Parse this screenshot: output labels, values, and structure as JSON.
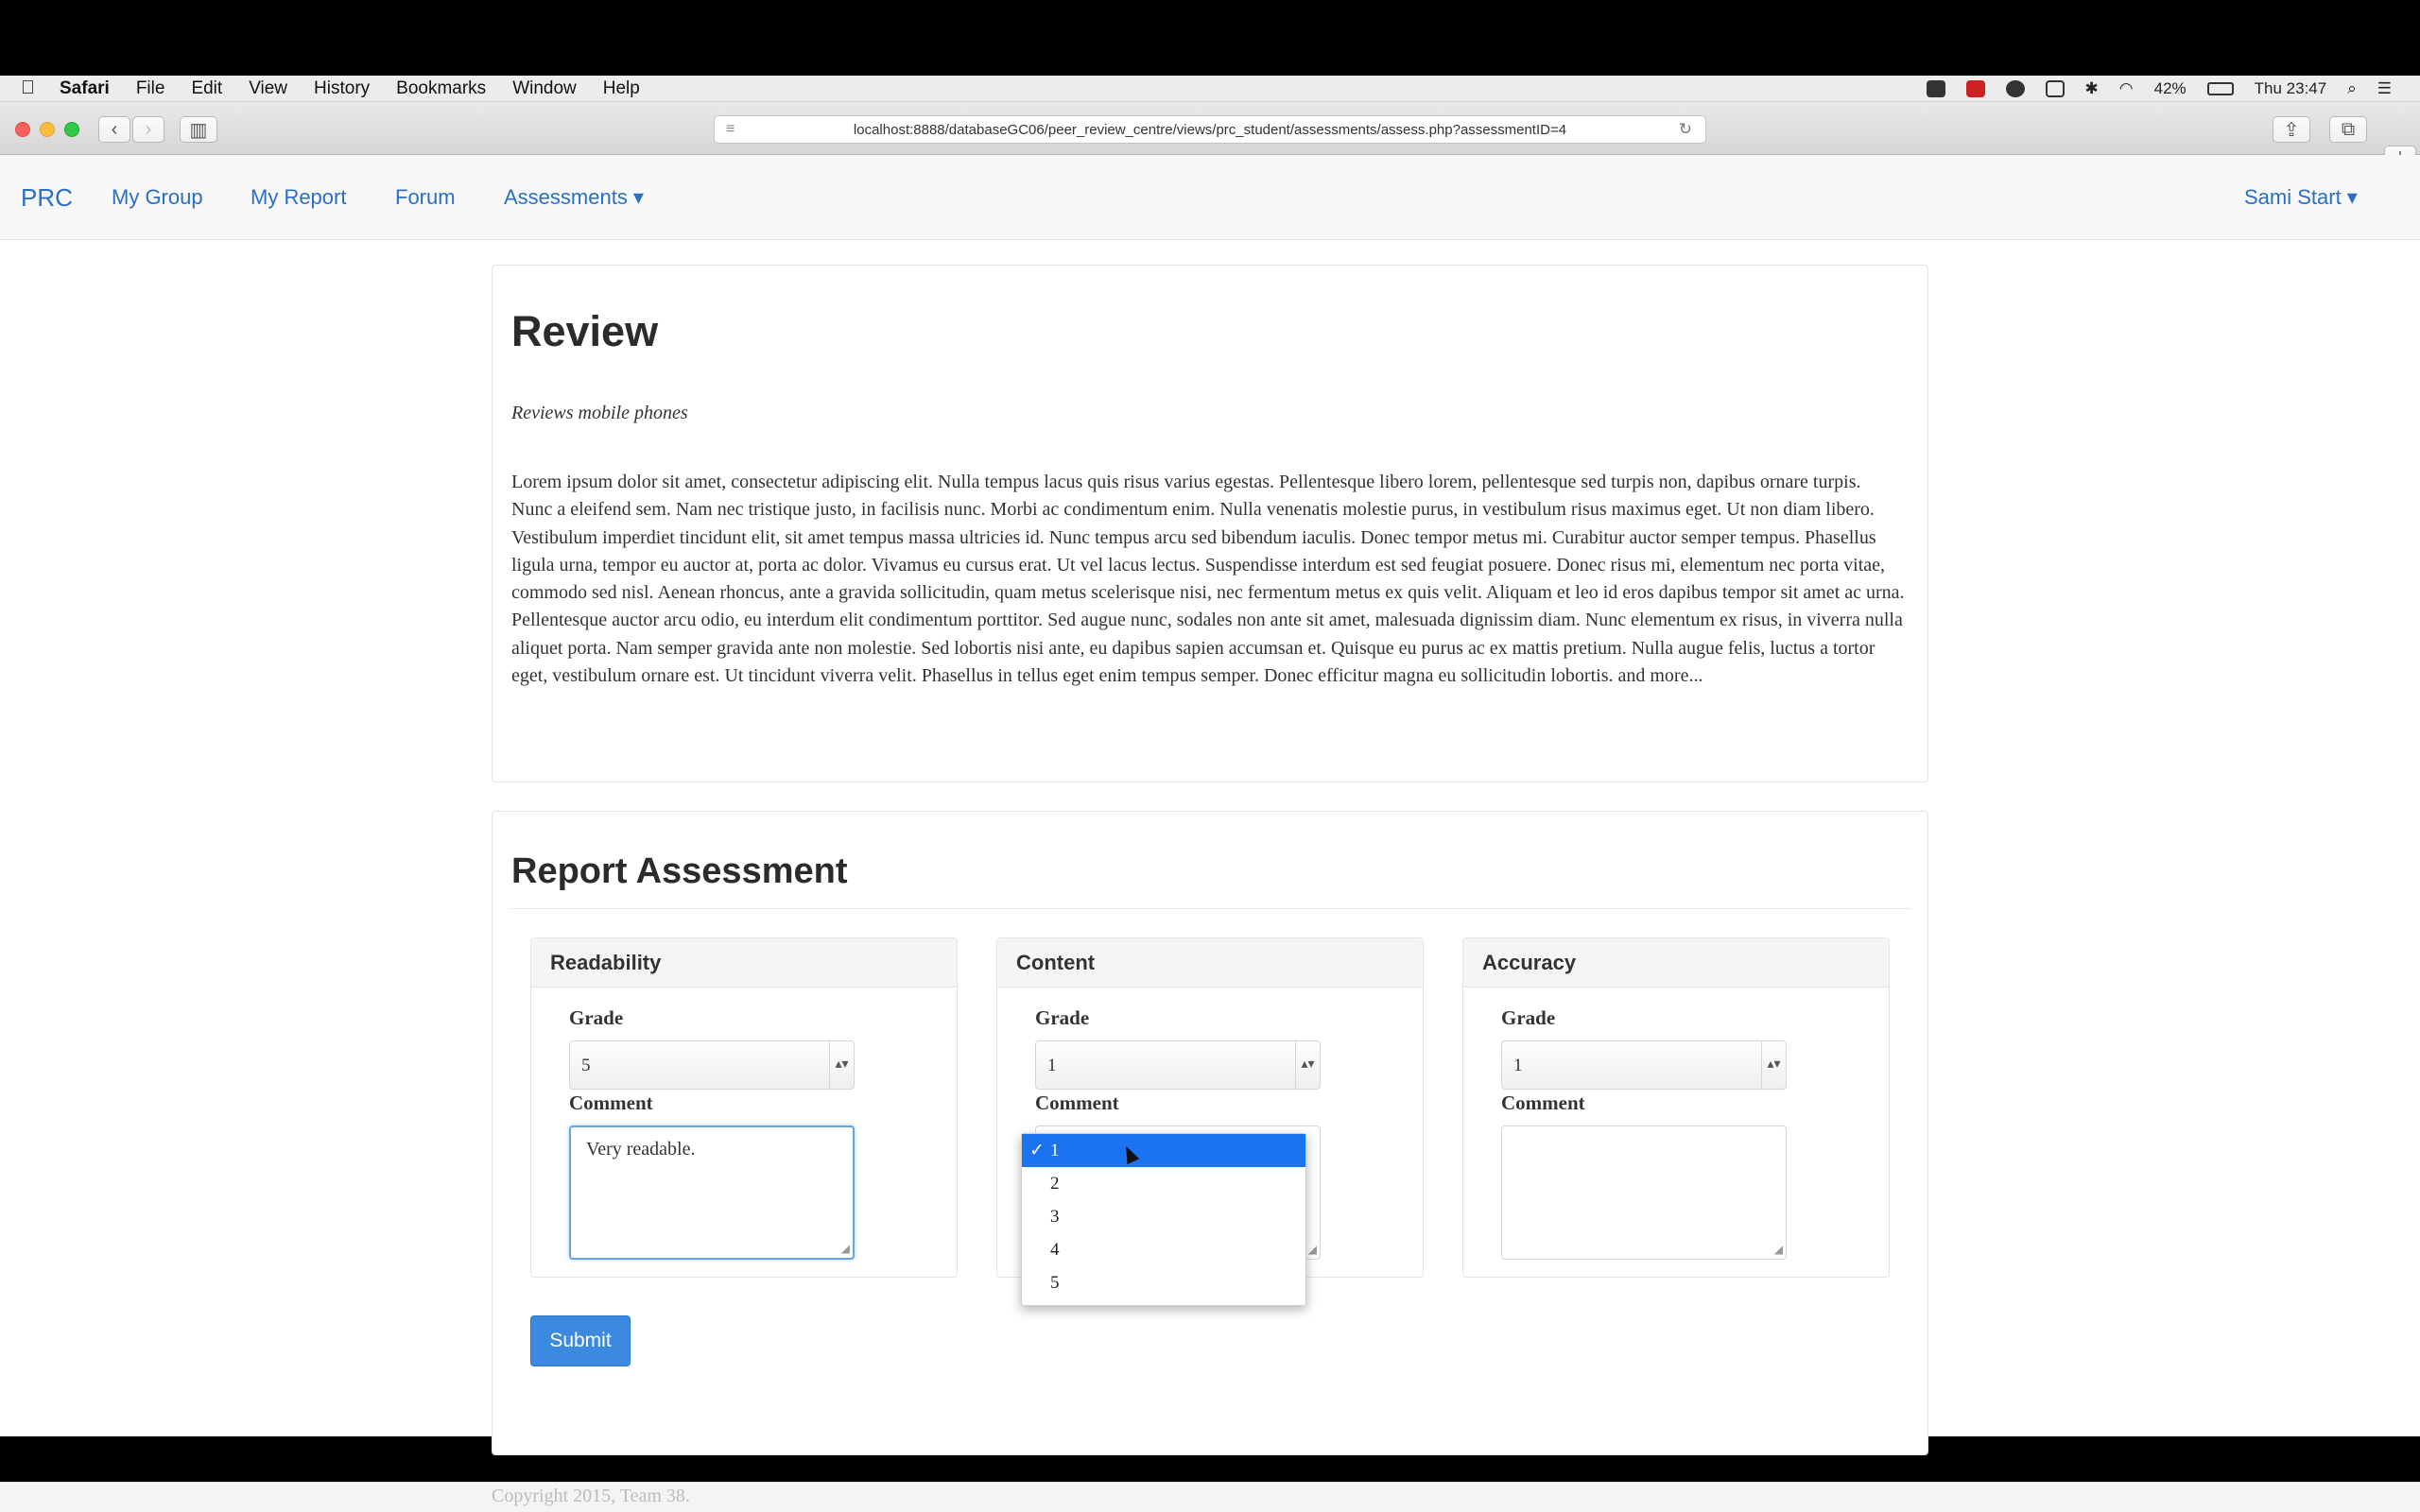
{
  "menubar": {
    "apple": "",
    "items": [
      "Safari",
      "File",
      "Edit",
      "View",
      "History",
      "Bookmarks",
      "Window",
      "Help"
    ],
    "status": {
      "battery": "42%",
      "clock": "Thu 23:47"
    }
  },
  "toolbar": {
    "url": "localhost:8888/databaseGC06/peer_review_centre/views/prc_student/assessments/assess.php?assessmentID=4",
    "back_glyph": "‹",
    "forward_glyph": "›",
    "sidebar_glyph": "▥",
    "reload_glyph": "↻",
    "reader_glyph": "≡",
    "share_glyph": "⇪",
    "tabs_glyph": "⧉",
    "newtab_glyph": "+"
  },
  "navbar": {
    "brand": "PRC",
    "links": [
      "My Group",
      "My Report",
      "Forum",
      "Assessments ▾"
    ],
    "user": "Sami Start ▾"
  },
  "review": {
    "title": "Review",
    "subtitle": "Reviews mobile phones",
    "body": "Lorem ipsum dolor sit amet, consectetur adipiscing elit. Nulla tempus lacus quis risus varius egestas. Pellentesque libero lorem, pellentesque sed turpis non, dapibus ornare turpis. Nunc a eleifend sem. Nam nec tristique justo, in facilisis nunc. Morbi ac condimentum enim. Nulla venenatis molestie purus, in vestibulum risus maximus eget. Ut non diam libero. Vestibulum imperdiet tincidunt elit, sit amet tempus massa ultricies id. Nunc tempus arcu sed bibendum iaculis. Donec tempor metus mi. Curabitur auctor semper tempus. Phasellus ligula urna, tempor eu auctor at, porta ac dolor. Vivamus eu cursus erat. Ut vel lacus lectus. Suspendisse interdum est sed feugiat posuere. Donec risus mi, elementum nec porta vitae, commodo sed nisl. Aenean rhoncus, ante a gravida sollicitudin, quam metus scelerisque nisi, nec fermentum metus ex quis velit. Aliquam et leo id eros dapibus tempor sit amet ac urna. Pellentesque auctor arcu odio, eu interdum elit condimentum porttitor. Sed augue nunc, sodales non ante sit amet, malesuada dignissim diam. Nunc elementum ex risus, in viverra nulla aliquet porta. Nam semper gravida ante non molestie. Sed lobortis nisi ante, eu dapibus sapien accumsan et. Quisque eu purus ac ex mattis pretium. Nulla augue felis, luctus a tortor eget, vestibulum ornare est. Ut tincidunt viverra velit. Phasellus in tellus eget enim tempus semper. Donec efficitur magna eu sollicitudin lobortis. and more..."
  },
  "assessment": {
    "title": "Report Assessment",
    "grade_label": "Grade",
    "comment_label": "Comment",
    "cards": [
      {
        "title": "Readability",
        "grade": "5",
        "comment": "Very readable."
      },
      {
        "title": "Content",
        "grade": "1",
        "comment": ""
      },
      {
        "title": "Accuracy",
        "grade": "1",
        "comment": ""
      }
    ],
    "dropdown_options": [
      "1",
      "2",
      "3",
      "4",
      "5"
    ],
    "dropdown_selected": "1",
    "check_glyph": "✓",
    "submit_label": "Submit"
  },
  "footer": {
    "copyright": "Copyright 2015, Team 38."
  },
  "colors": {
    "link": "#2a6fc4",
    "primary": "#3c8ae0",
    "highlight": "#1a73f0"
  }
}
